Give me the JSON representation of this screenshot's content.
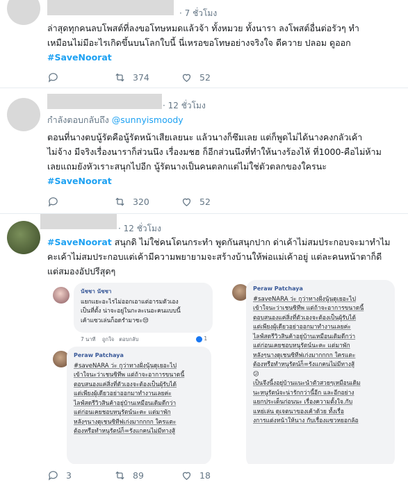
{
  "tweets": [
    {
      "time": "· 7 ชั่วโมง",
      "text_lines": [
        "ล่าสุดทุกคนลบโพสต์ที่ลงขอโทษหมดแล้วจ้า ทั้งหมวย ทั้งนารา ลงโพสต์อื่นต่อรัวๆ ทำ",
        "เหมือนไม่มีอะไรเกิดขึ้นบนโลกใบนี้ นี่เหรอขอโทษอย่างจริงใจ ดีควาย ปลอม ดูออก"
      ],
      "hashtag": "#SaveNoorat",
      "replies": "",
      "retweets": "374",
      "likes": "52"
    },
    {
      "time": "· 12 ชั่วโมง",
      "reply_prefix": "กำลังตอบกลับถึง",
      "reply_handle": "@sunnyismoody",
      "text_lines": [
        "ตอนที่นางตบนู้รัตคือนู้รัตหน้าเสียเลยนะ แล้วนางก็ซึมเลย  แต่ก็พูดไม่ได้นางคงกลัวเค้า",
        "ไม่จ้าง มีจริงเรื่องนาราก็ส่วนนึง เรื่องมชฮ ก็อีกส่วนนึงที่ทำให้นางร้องไห้ ที่1000-คือไม่ห้าม",
        "เลยแถมยังหัวเราะสนุกไปอีก นู้รัตนางเป็นคนตลกแต่ไม่ใช่ตัวตลกของใครนะ"
      ],
      "hashtag": "#SaveNoorat",
      "replies": "",
      "retweets": "320",
      "likes": "52"
    },
    {
      "time": "· 12 ชั่วโมง",
      "hashtag": "#SaveNoorat",
      "text_lines": [
        " สนุกดิ ไม่ใช่คนโดนกระทำ พูดกันสนุกปาก ด่าเค้าไม่สมประกอบจะมาทำไม",
        "คะเค้าไม่สมประกอบแต่เค้ามีความพยายามจะสร้างบ้านให้พ่อแม่เค้าอยู่ แต่ละคนหน้าตาก็ดี",
        "แต่สมองอัปปรีสุดๆ"
      ],
      "replies": "3",
      "retweets": "89",
      "likes": "18",
      "embed": {
        "c1_name": "นัชชา นัชชา",
        "c1_lines": [
          "แยกแยะอะไรไม่ออกเอาแต่อารมตัวเอง",
          "เป็นที่ตั้ง น่าจะอยู่ในกะละเนอะคนแบบนี้",
          "เค้าแซวเล่นก็อดรำมาซะ😒"
        ],
        "c1_meta": [
          "7 นาที",
          "ถูกใจ",
          "ตอบกลับ"
        ],
        "c1_react": "1",
        "c2_name": "Peraw Patchaya",
        "c2_lines": [
          "#saveNARA ว่ะ กูว่าทางฝั่งนู้นดูเยอะไป",
          "เข้าใจนะว่าเชนซิทีพ แต่ถ้าจะอาการขนาดนี้",
          "ตอบสนองแค่สิ่งที่ตัวเองจะต้องเป็นผู้รับได้",
          "แต่เพียงผู้เดียวอย่าออกมาทำงานเลยค่ะ",
          "ไลฟ์สดรีวิวสินค้าอยู่บ้านเหมือนเดิมดีกว่า",
          "แต่ก่อนเคยชอบหนูรัตน์นะคะ แต่มาพัก",
          "หลังๆนางดูเชนซิทีฟเก่งมากกกก ใครแตะ",
          "ต้องหรือทำหนูรัตน์ก็=รังแกคนไม่มีทางสู้"
        ],
        "c3_name": "Peraw Patchaya",
        "c3_lines": [
          "#saveNARA ว่ะ กูว่าทางฝั่งนู้นดูเยอะไป",
          "เข้าใจนะว่าเชนซิทีพ แต่ถ้าจะอาการขนาดนี้",
          "ตอบสนองแค่สิ่งที่ตัวเองจะต้องเป็นผู้รับได้",
          "แต่เพียงผู้เดียวอย่าออกมาทำงานเลยค่ะ",
          "ไลฟ์สดรีวิวสินค้าอยู่บ้านเหมือนเดิมดีกว่า",
          "แต่ก่อนเคยชอบหนูรัตน์นะคะ แต่มาพัก",
          "หลังๆนางดูเชนซิทีฟเก่งมากกกก ใครแตะ",
          "ต้องหรือทำหนูรัตน์ก็=รังแกคนไม่มีทางสู้",
          "😕",
          "เป็นจึงนี้งอยู่บ้านแนะนำตัวสวยๆเหมือนเดิม",
          "นะหนูรัตน์จะน่ารักกว่านี้อีก และอีกอย่าง",
          "แยกประเด็นก่อนนะ เรื่องความตั้งใจ.กับ",
          "แหย่เล่น ดูเจตนาของเค้าด้วย ทั้งเรื่อ",
          "งการแต่งหน้าให้นาง กับเรื่องแซวหยอกล้อ"
        ]
      }
    }
  ]
}
